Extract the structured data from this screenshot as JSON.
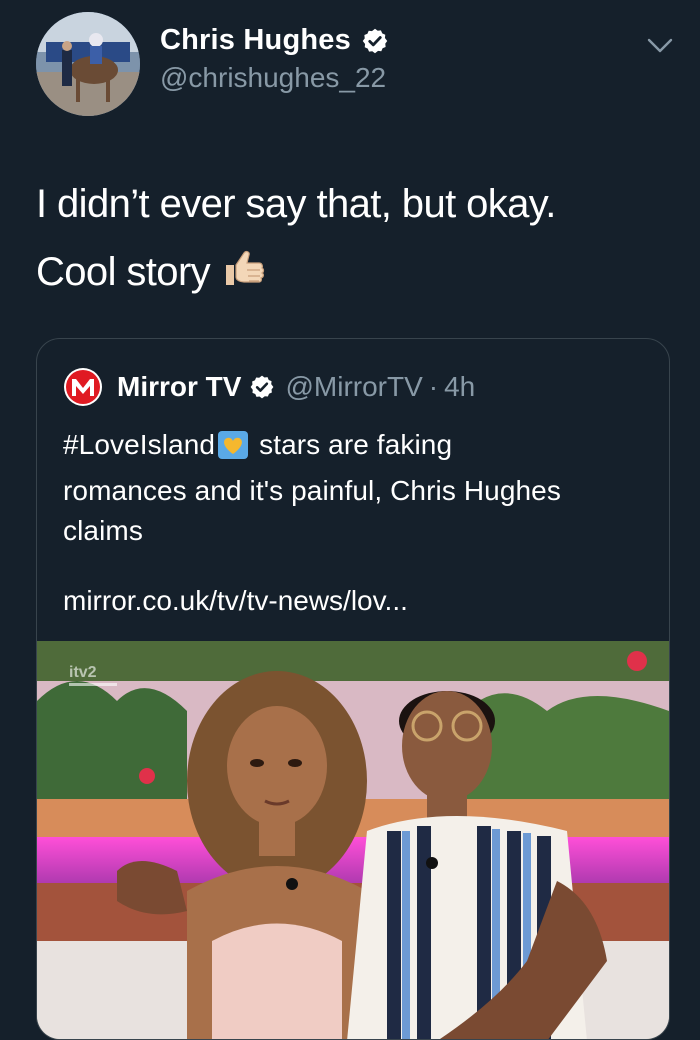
{
  "author": {
    "name": "Chris Hughes",
    "handle": "@chrishughes_22",
    "verified": true
  },
  "tweet": {
    "line1": "I didn’t ever say that, but okay.",
    "line2": "Cool story",
    "emoji": "thumbs-up"
  },
  "quoted": {
    "name": "Mirror TV",
    "handle": "@MirrorTV",
    "separator": "·",
    "time": "4h",
    "verified": true,
    "hashtag": "#LoveIsland",
    "line1_rest": "stars are faking",
    "line2": "romances and it's painful, Chris Hughes",
    "line3": "claims",
    "link": "mirror.co.uk/tv/tv-news/lov...",
    "image_badge": "itv2"
  },
  "colors": {
    "background": "#15202b",
    "secondary_text": "#8899a6",
    "border": "#38444d",
    "mirror_red": "#e01a22"
  }
}
